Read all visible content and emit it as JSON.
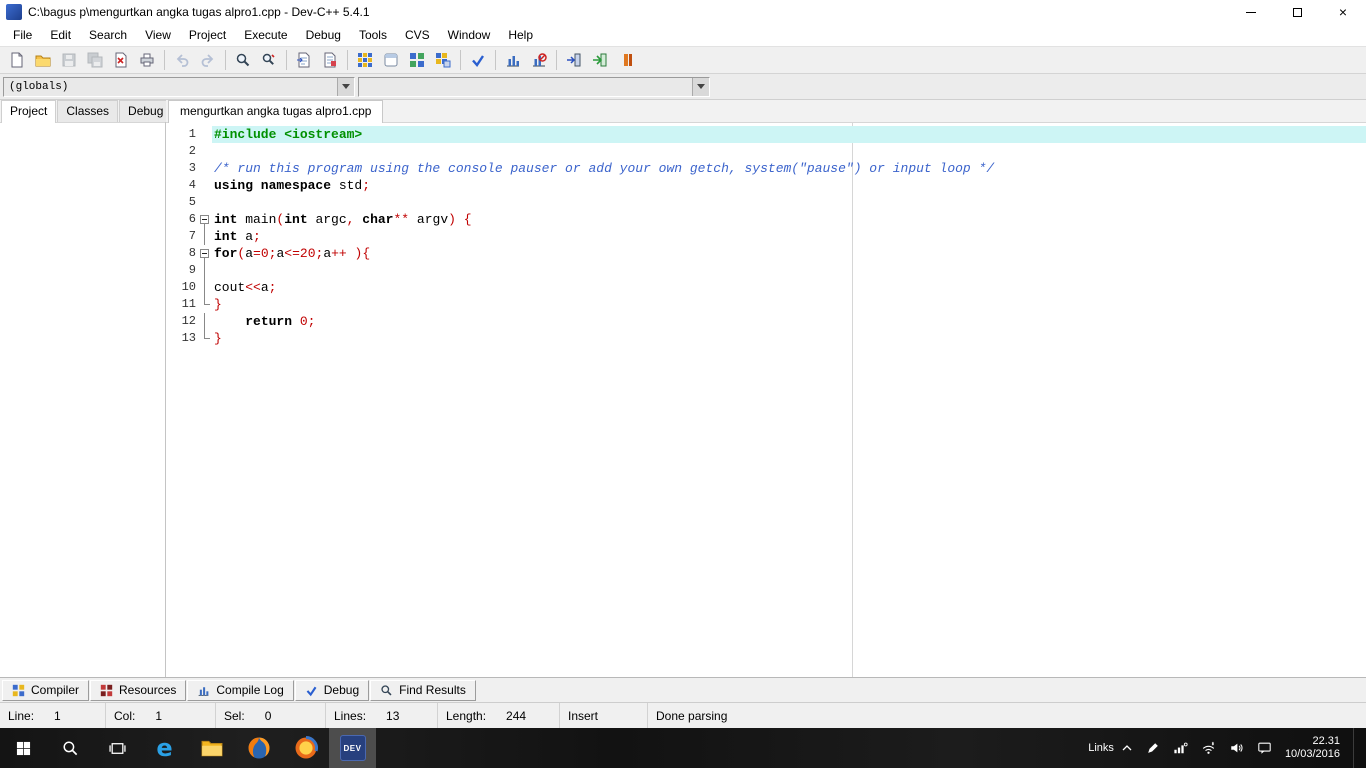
{
  "titlebar": {
    "title": "C:\\bagus p\\mengurtkan angka tugas alpro1.cpp - Dev-C++ 5.4.1"
  },
  "menu": [
    "File",
    "Edit",
    "Search",
    "View",
    "Project",
    "Execute",
    "Debug",
    "Tools",
    "CVS",
    "Window",
    "Help"
  ],
  "navigation": {
    "globals_combo": "(globals)",
    "members_combo": ""
  },
  "panel_tabs": [
    "Project",
    "Classes",
    "Debug"
  ],
  "editor": {
    "tab_title": "mengurtkan angka tugas alpro1.cpp",
    "lines": [
      {
        "no": 1,
        "hl": true,
        "tokens": [
          [
            "#include <iostream>",
            "pre"
          ]
        ]
      },
      {
        "no": 2,
        "tokens": []
      },
      {
        "no": 3,
        "tokens": [
          [
            "/* run this program using the console pauser or add your own getch, system(\"pause\") or input loop */",
            "com"
          ]
        ]
      },
      {
        "no": 4,
        "tokens": [
          [
            "using namespace",
            "kw"
          ],
          [
            " std",
            "pl"
          ],
          [
            ";",
            "sym"
          ]
        ]
      },
      {
        "no": 5,
        "tokens": []
      },
      {
        "no": 6,
        "fold": "minus",
        "tokens": [
          [
            "int",
            "kw"
          ],
          [
            " main",
            "pl"
          ],
          [
            "(",
            "sym"
          ],
          [
            "int",
            "kw"
          ],
          [
            " argc",
            "pl"
          ],
          [
            ",",
            "sym"
          ],
          [
            " ",
            "pl"
          ],
          [
            "char",
            "kw"
          ],
          [
            "**",
            "sym"
          ],
          [
            " argv",
            "pl"
          ],
          [
            ")",
            "sym"
          ],
          [
            " {",
            "sym"
          ]
        ]
      },
      {
        "no": 7,
        "fold": "line",
        "tokens": [
          [
            "int",
            "kw"
          ],
          [
            " a",
            "pl"
          ],
          [
            ";",
            "sym"
          ]
        ]
      },
      {
        "no": 8,
        "fold": "minus",
        "tokens": [
          [
            "for",
            "kw"
          ],
          [
            "(",
            "sym"
          ],
          [
            "a",
            "pl"
          ],
          [
            "=",
            "sym"
          ],
          [
            "0",
            "num"
          ],
          [
            ";",
            "sym"
          ],
          [
            "a",
            "pl"
          ],
          [
            "<=",
            "sym"
          ],
          [
            "20",
            "num"
          ],
          [
            ";",
            "sym"
          ],
          [
            "a",
            "pl"
          ],
          [
            "++",
            "sym"
          ],
          [
            " ",
            "pl"
          ],
          [
            "){",
            "sym"
          ]
        ]
      },
      {
        "no": 9,
        "fold": "line",
        "tokens": []
      },
      {
        "no": 10,
        "fold": "line",
        "tokens": [
          [
            "cout",
            "pl"
          ],
          [
            "<<",
            "sym"
          ],
          [
            "a",
            "pl"
          ],
          [
            ";",
            "sym"
          ]
        ]
      },
      {
        "no": 11,
        "fold": "end",
        "tokens": [
          [
            "}",
            "sym"
          ]
        ]
      },
      {
        "no": 12,
        "fold": "line",
        "tokens": [
          [
            "    ",
            "pl"
          ],
          [
            "return",
            "kw"
          ],
          [
            " ",
            "pl"
          ],
          [
            "0",
            "num"
          ],
          [
            ";",
            "sym"
          ]
        ]
      },
      {
        "no": 13,
        "fold": "end",
        "tokens": [
          [
            "}",
            "sym"
          ]
        ]
      }
    ]
  },
  "bottom_tabs": [
    {
      "label": "Compiler"
    },
    {
      "label": "Resources"
    },
    {
      "label": "Compile Log"
    },
    {
      "label": "Debug"
    },
    {
      "label": "Find Results"
    }
  ],
  "status": {
    "segments": [
      {
        "label": "Line:",
        "value": "1"
      },
      {
        "label": "Col:",
        "value": "1"
      },
      {
        "label": "Sel:",
        "value": "0"
      },
      {
        "label": "Lines:",
        "value": "13"
      },
      {
        "label": "Length:",
        "value": "244"
      }
    ],
    "mode": "Insert",
    "message": "Done parsing"
  },
  "taskbar": {
    "links_label": "Links",
    "devcpp_label": "DEV",
    "clock": {
      "time": "22.31",
      "date": "10/03/2016"
    }
  },
  "icons": {
    "edge_glyph": "e",
    "named": [
      "new-file-icon",
      "open-icon",
      "save-icon",
      "save-all-icon",
      "close-file-icon",
      "print-icon",
      "undo-icon",
      "redo-icon",
      "find-icon",
      "replace-icon",
      "goto-line-icon",
      "incremental-search-icon",
      "compile-icon",
      "run-icon",
      "compile-run-icon",
      "rebuild-icon",
      "syntax-check-icon",
      "profile-icon",
      "delete-profiling-icon",
      "insert-snippet-icon",
      "toggle-bookmark-icon",
      "goto-bookmark-icon",
      "windows-start-icon",
      "search-icon",
      "task-view-icon",
      "edge-icon",
      "file-explorer-icon",
      "firefox-icon",
      "app-icon",
      "devcpp-icon",
      "pen-icon",
      "cellular-icon",
      "wifi-icon",
      "volume-icon",
      "notification-icon",
      "chevron-up-icon"
    ]
  },
  "colors": {
    "preprocessor": "#009000",
    "comment": "#3c64cc",
    "symbol": "#c00000",
    "line_highlight": "#cdf5f5",
    "taskbar_bg": "#161616",
    "devcpp_blue": "#27407e"
  }
}
